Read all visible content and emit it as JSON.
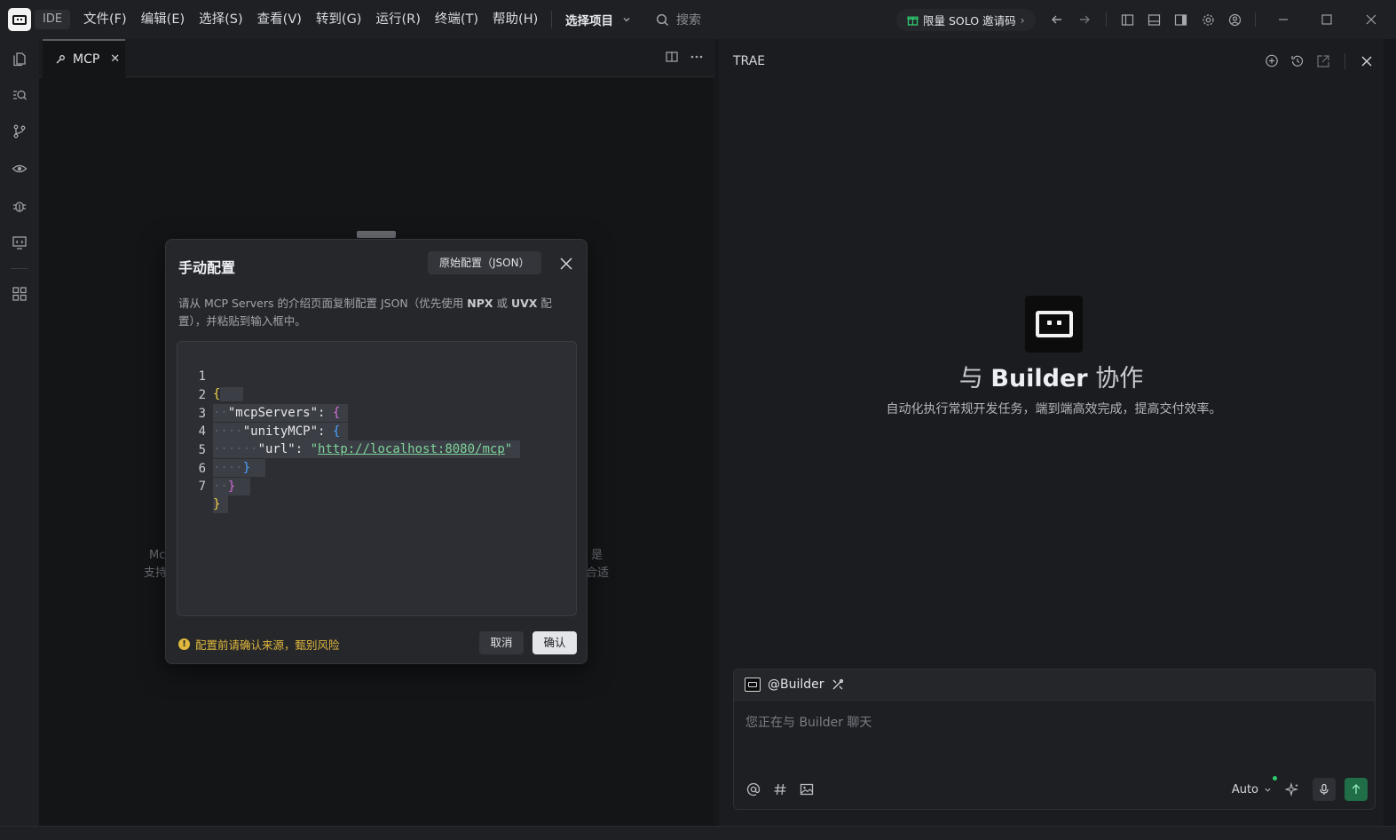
{
  "titlebar": {
    "ide_badge": "IDE",
    "menu": [
      "文件(F)",
      "编辑(E)",
      "选择(S)",
      "查看(V)",
      "转到(G)",
      "运行(R)",
      "终端(T)",
      "帮助(H)"
    ],
    "project_select": "选择项目",
    "search_placeholder": "搜索",
    "solo_invite": "限量 SOLO 邀请码"
  },
  "editor": {
    "tab_label": "MCP",
    "bg_text_left": [
      "Mc",
      "支持"
    ],
    "bg_text_right": [
      "是",
      "合适"
    ]
  },
  "modal": {
    "title": "手动配置",
    "raw_config_button": "原始配置（JSON）",
    "description_prefix": "请从 MCP Servers 的介绍页面复制配置 JSON（优先使用 ",
    "description_npx": "NPX",
    "description_or": " 或 ",
    "description_uvx": "UVX",
    "description_suffix": " 配置），并粘贴到输入框中。",
    "line_numbers": [
      "1",
      "2",
      "3",
      "4",
      "5",
      "6",
      "7"
    ],
    "json": {
      "key_servers": "\"mcpServers\"",
      "key_unity": "\"unityMCP\"",
      "key_url": "\"url\"",
      "url_value": "http://localhost:8080/mcp"
    },
    "warning": "配置前请确认来源，甄别风险",
    "cancel_button": "取消",
    "confirm_button": "确认"
  },
  "right_panel": {
    "title": "TRAE",
    "hero_title_prefix": "与 ",
    "hero_title_bold": "Builder",
    "hero_title_suffix": " 协作",
    "hero_subtitle": "自动化执行常规开发任务，端到端高效完成，提高交付效率。",
    "chat_agent": "@Builder",
    "chat_placeholder": "您正在与 Builder 聊天",
    "model_select": "Auto"
  },
  "colors": {
    "accent_green": "#2ecc71",
    "warning_yellow": "#e0b83c",
    "send_button": "#1f6e48"
  }
}
